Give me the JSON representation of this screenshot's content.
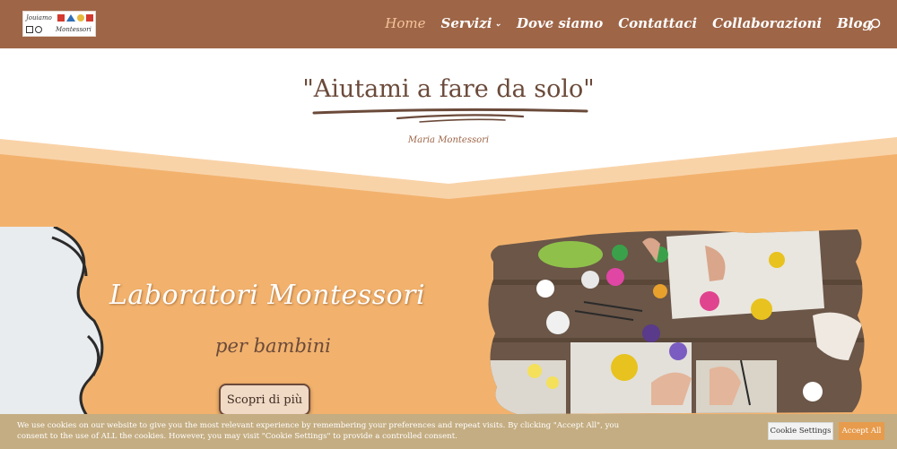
{
  "header": {
    "logo_line1": "Jouiamo",
    "logo_line2": "Montessori",
    "nav": [
      {
        "label": "Home",
        "active": true
      },
      {
        "label": "Servizi",
        "has_dropdown": true
      },
      {
        "label": "Dove siamo"
      },
      {
        "label": "Contattaci"
      },
      {
        "label": "Collaborazioni"
      },
      {
        "label": "Blog"
      }
    ]
  },
  "hero": {
    "quote": "\"Aiutami a fare da solo\"",
    "author": "Maria Montessori"
  },
  "lab": {
    "title": "Laboratori Montessori",
    "subtitle": "per bambini",
    "button": "Scopri di più"
  },
  "cookie": {
    "text": "We use cookies on our website to give you the most relevant experience by remembering your preferences and repeat visits. By clicking \"Accept All\", you consent to the use of ALL the cookies. However, you may visit \"Cookie Settings\" to provide a controlled consent.",
    "settings_label": "Cookie Settings",
    "accept_label": "Accept All"
  },
  "colors": {
    "header_bg": "#9e6547",
    "nav_active": "#f4c49a",
    "section_orange": "#f2b26d",
    "wave_light": "#f9d3a8",
    "text_brown": "#6b4a3a",
    "cookie_bg": "#c4ad82",
    "accept_bg": "#e79b4c"
  },
  "icons": {
    "search": "search-icon",
    "dropdown": "chevron-down-icon"
  }
}
